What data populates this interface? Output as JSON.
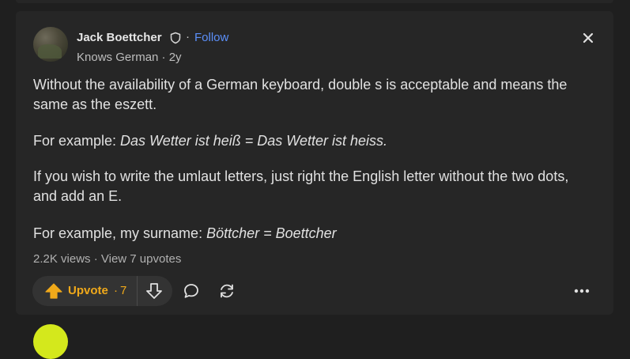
{
  "answer": {
    "author": {
      "name": "Jack Boettcher",
      "follow_label": "Follow",
      "separator": "·",
      "credential": "Knows German · 2y"
    },
    "paragraphs": [
      {
        "text": "Without the availability of a German keyboard, double s is acceptable and means the same as the eszett."
      },
      {
        "prefix": "For example: ",
        "italic": "Das Wetter ist heiß = Das Wetter ist heiss."
      },
      {
        "text": "If you wish to write the umlaut letters, just right the English letter without the two dots, and add an E."
      },
      {
        "prefix": "For example, my surname: ",
        "italic": "Böttcher = Boettcher"
      }
    ],
    "stats": {
      "views": "2.2K views",
      "separator": " · ",
      "upvotes_link": "View 7 upvotes"
    },
    "actions": {
      "upvote_label": "Upvote",
      "upvote_sep": "·",
      "upvote_count": "7"
    }
  },
  "icons": {
    "shield": "shield-icon",
    "close": "close-icon",
    "upvote": "upvote-arrow-icon",
    "downvote": "downvote-arrow-icon",
    "comment": "comment-bubble-icon",
    "share": "reshare-icon",
    "more": "more-dots-icon"
  },
  "colors": {
    "background": "#1f1f1f",
    "card": "#262626",
    "accent_blue": "#5b8ff9",
    "upvote_gold": "#f0a91a",
    "text": "#e1e1e1"
  }
}
